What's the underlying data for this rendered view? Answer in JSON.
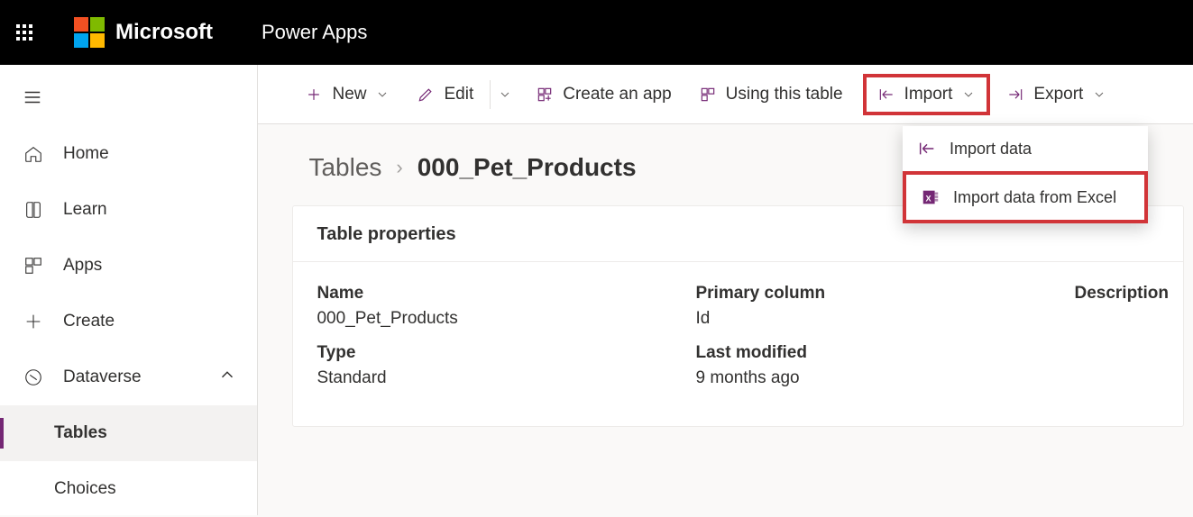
{
  "header": {
    "brand": "Microsoft",
    "app": "Power Apps"
  },
  "sidebar": {
    "items": [
      {
        "label": "Home"
      },
      {
        "label": "Learn"
      },
      {
        "label": "Apps"
      },
      {
        "label": "Create"
      },
      {
        "label": "Dataverse"
      },
      {
        "label": "Tables"
      },
      {
        "label": "Choices"
      }
    ]
  },
  "toolbar": {
    "new": "New",
    "edit": "Edit",
    "createApp": "Create an app",
    "usingTable": "Using this table",
    "import": "Import",
    "export": "Export"
  },
  "importMenu": {
    "data": "Import data",
    "excel": "Import data from Excel"
  },
  "breadcrumb": {
    "parent": "Tables",
    "current": "000_Pet_Products"
  },
  "card": {
    "title": "Table properties",
    "labels": {
      "name": "Name",
      "primary": "Primary column",
      "description": "Description",
      "type": "Type",
      "modified": "Last modified"
    },
    "values": {
      "name": "000_Pet_Products",
      "primary": "Id",
      "description": "",
      "type": "Standard",
      "modified": "9 months ago"
    }
  }
}
